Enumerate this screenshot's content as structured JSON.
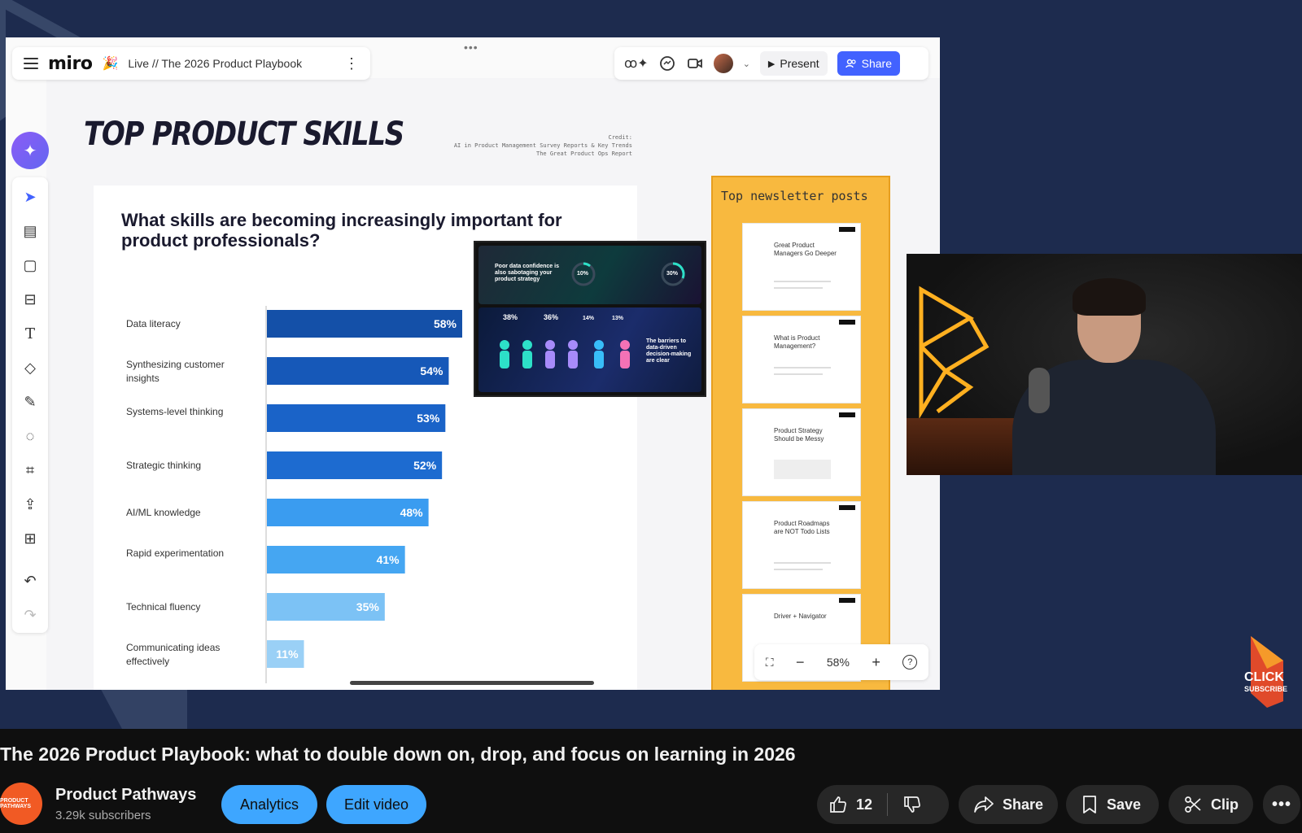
{
  "miro": {
    "logo": "miro",
    "board_title": "Live // The 2026 Product Playbook",
    "present_label": "Present",
    "share_label": "Share",
    "zoom_level": "58%"
  },
  "slide": {
    "title": "TOP PRODUCT SKILLS",
    "credit_lines": [
      "Credit:",
      "AI in Product Management Survey Reports & Key Trends",
      "The Great Product Ops Report"
    ],
    "question": "What skills are becoming increasingly important for product professionals?"
  },
  "chart_data": {
    "type": "bar",
    "orientation": "horizontal",
    "title": "What skills are becoming increasingly important for product professionals?",
    "categories": [
      "Data literacy",
      "Synthesizing customer insights",
      "Systems-level thinking",
      "Strategic thinking",
      "AI/ML knowledge",
      "Rapid experimentation",
      "Technical fluency",
      "Communicating ideas effectively"
    ],
    "values": [
      58,
      54,
      53,
      52,
      48,
      41,
      35,
      11
    ],
    "value_labels": [
      "58%",
      "54%",
      "53%",
      "52%",
      "48%",
      "41%",
      "35%",
      "11%"
    ],
    "colors": [
      "#1450a8",
      "#1658b8",
      "#1a63c8",
      "#1d6bd0",
      "#3a9cf0",
      "#45a6f2",
      "#7cc2f5",
      "#9ad0f6"
    ]
  },
  "infographic": {
    "panel1_text": "Poor data confidence is also sabotaging your product strategy",
    "stat_a": "10%",
    "stat_b": "30%",
    "panel2_stats": [
      "38%",
      "36%",
      "14%",
      "13%"
    ],
    "panel2_text": "The barriers to data-driven decision-making are clear"
  },
  "newsletter": {
    "title": "Top newsletter posts",
    "posts": [
      "Great Product Managers Go Deeper",
      "What is Product Management?",
      "Product Strategy Should be Messy",
      "Product Roadmaps are NOT Todo Lists",
      "Driver + Navigator"
    ]
  },
  "overlay": {
    "click_label": "CLICK",
    "subscribe_label": "SUBSCRIBE"
  },
  "youtube": {
    "video_title": "The 2026 Product Playbook: what to double down on, drop, and focus on learning in 2026",
    "channel_name": "Product Pathways",
    "channel_avatar_text": "PRODUCT PATHWAYS",
    "subscribers": "3.29k subscribers",
    "analytics_label": "Analytics",
    "edit_video_label": "Edit video",
    "like_count": "12",
    "share_label": "Share",
    "save_label": "Save",
    "clip_label": "Clip"
  },
  "colors": {
    "video_bg": "#1d2b4e",
    "miro_blue": "#4262ff",
    "newsletter_bg": "#f8b93f",
    "youtube_blue": "#3ea6ff"
  }
}
